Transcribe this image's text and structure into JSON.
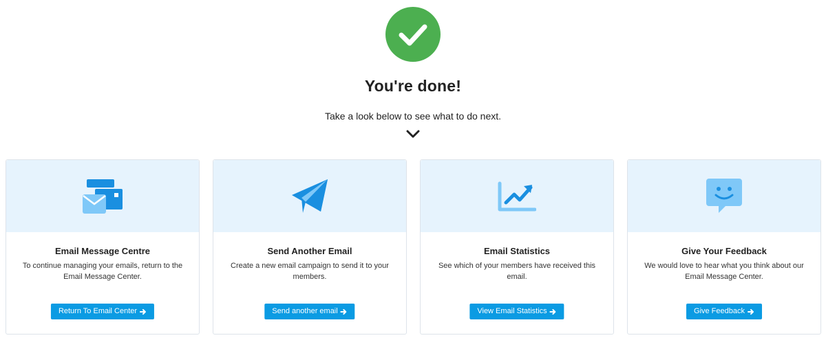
{
  "header": {
    "title": "You're done!",
    "subtitle": "Take a look below to see what to do next.",
    "success_icon": "check-circle-icon",
    "success_color": "#4caf50"
  },
  "cards": [
    {
      "icon": "email-envelope-icon",
      "title": "Email Message Centre",
      "description": "To continue managing your emails, return to the Email Message Center.",
      "button_label": "Return To Email Center"
    },
    {
      "icon": "paper-plane-icon",
      "title": "Send Another Email",
      "description": "Create a new email campaign to send it to your members.",
      "button_label": "Send another email"
    },
    {
      "icon": "trending-chart-icon",
      "title": "Email Statistics",
      "description": "See which of your members have received this email.",
      "button_label": "View Email Statistics"
    },
    {
      "icon": "feedback-chat-icon",
      "title": "Give Your Feedback",
      "description": "We would love to hear what you think about our Email Message Center.",
      "button_label": "Give Feedback"
    }
  ],
  "colors": {
    "accent": "#0b9be3",
    "card_header_bg": "#e6f3fd",
    "icon_dark": "#1a8fe0",
    "icon_light": "#7fc8f8"
  }
}
